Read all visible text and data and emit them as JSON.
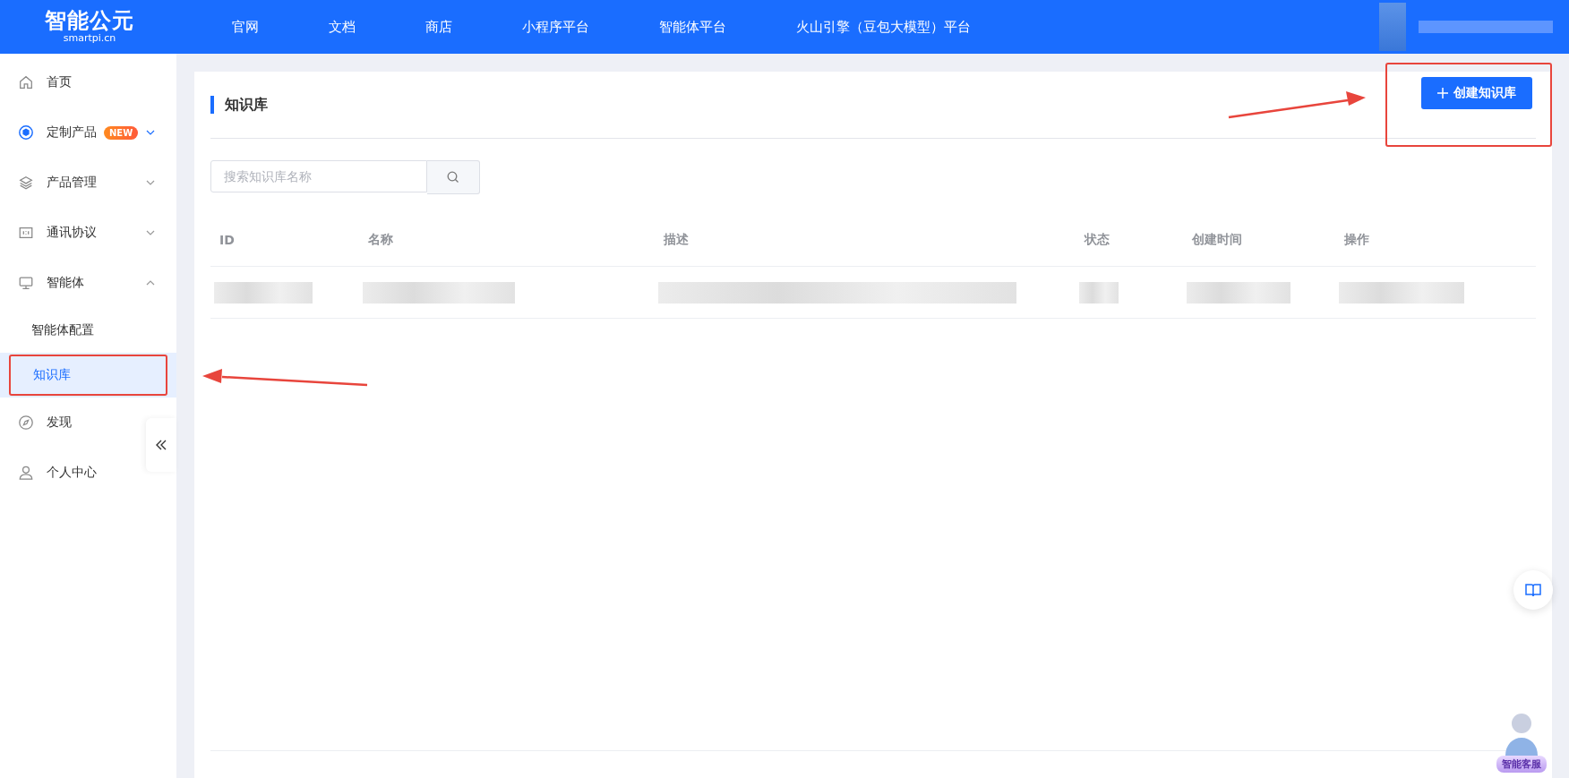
{
  "header": {
    "logo": {
      "title": "智能公元",
      "subtitle": "smartpi.cn"
    },
    "nav": [
      {
        "label": "官网"
      },
      {
        "label": "文档"
      },
      {
        "label": "商店"
      },
      {
        "label": "小程序平台"
      },
      {
        "label": "智能体平台"
      },
      {
        "label": "火山引擎（豆包大模型）平台"
      }
    ]
  },
  "sidebar": {
    "items": [
      {
        "kind": "item",
        "label": "首页"
      },
      {
        "kind": "item",
        "label": "定制产品",
        "badge": "NEW",
        "expanded": false
      },
      {
        "kind": "item",
        "label": "产品管理",
        "expanded": false
      },
      {
        "kind": "item",
        "label": "通讯协议",
        "expanded": false
      },
      {
        "kind": "item",
        "label": "智能体",
        "expanded": true,
        "children": [
          {
            "label": "智能体配置",
            "selected": false,
            "highlighted": false
          },
          {
            "label": "知识库",
            "selected": true,
            "highlighted": true
          }
        ]
      },
      {
        "kind": "item",
        "label": "发现"
      },
      {
        "kind": "item",
        "label": "个人中心"
      }
    ]
  },
  "page": {
    "title": "知识库",
    "create_button": {
      "label": "创建知识库",
      "highlighted": true
    },
    "search": {
      "placeholder": "搜索知识库名称"
    },
    "table": {
      "columns": [
        "ID",
        "名称",
        "描述",
        "状态",
        "创建时间",
        "操作"
      ]
    }
  },
  "float": {
    "support_label": "智能客服"
  }
}
